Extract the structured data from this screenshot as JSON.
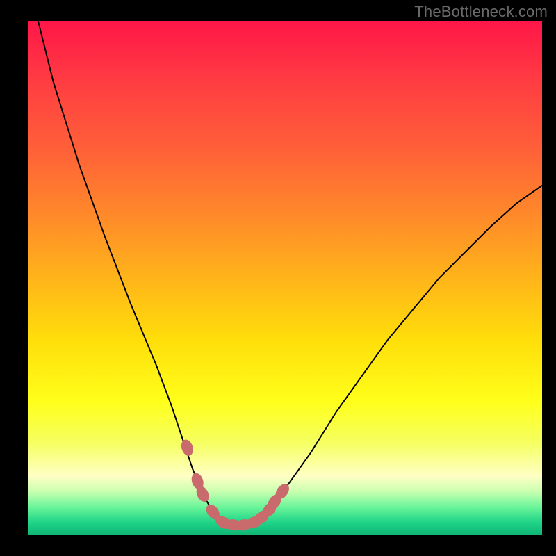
{
  "watermark": {
    "text": "TheBottleneck.com"
  },
  "colors": {
    "background": "#000000",
    "curve_stroke": "#000000",
    "marker_fill": "#c96a6c",
    "gradient_stops": [
      {
        "offset": 0.0,
        "color": "#ff1648"
      },
      {
        "offset": 0.12,
        "color": "#ff3d42"
      },
      {
        "offset": 0.25,
        "color": "#ff6038"
      },
      {
        "offset": 0.38,
        "color": "#ff8a2a"
      },
      {
        "offset": 0.5,
        "color": "#ffb41a"
      },
      {
        "offset": 0.62,
        "color": "#ffde0a"
      },
      {
        "offset": 0.74,
        "color": "#ffff1a"
      },
      {
        "offset": 0.82,
        "color": "#f5ff60"
      },
      {
        "offset": 0.885,
        "color": "#ffffc4"
      },
      {
        "offset": 0.915,
        "color": "#c9ffb0"
      },
      {
        "offset": 0.945,
        "color": "#6cf59a"
      },
      {
        "offset": 0.975,
        "color": "#1fd488"
      },
      {
        "offset": 1.0,
        "color": "#0fb574"
      }
    ]
  },
  "chart_data": {
    "type": "line",
    "title": "",
    "xlabel": "",
    "ylabel": "",
    "xlim": [
      0,
      100
    ],
    "ylim": [
      0,
      100
    ],
    "grid": false,
    "x": [
      2,
      5,
      10,
      15,
      20,
      25,
      28,
      30,
      32,
      34,
      36,
      38,
      40,
      42,
      44,
      46,
      50,
      55,
      60,
      65,
      70,
      75,
      80,
      85,
      90,
      95,
      100
    ],
    "series": [
      {
        "name": "bottleneck-curve",
        "values": [
          100,
          88,
          72,
          58,
          45,
          33,
          25,
          19,
          13,
          8,
          4.5,
          2.5,
          2,
          2,
          2.5,
          4,
          9,
          16,
          24,
          31,
          38,
          44,
          50,
          55,
          60,
          64.5,
          68
        ]
      }
    ],
    "markers": {
      "name": "optimal-range",
      "x": [
        31,
        33,
        34,
        36,
        38,
        40,
        42,
        44,
        45.5,
        47,
        48,
        49.5
      ],
      "y": [
        17,
        10.5,
        8,
        4.5,
        2.5,
        2,
        2,
        2.5,
        3.5,
        5,
        6.5,
        8.5
      ]
    }
  }
}
